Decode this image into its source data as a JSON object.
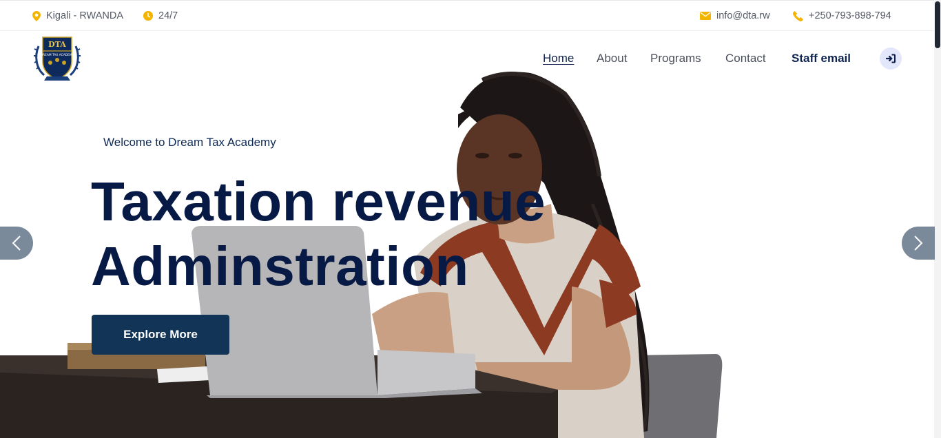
{
  "topbar": {
    "location": "Kigali - RWANDA",
    "hours": "24/7",
    "email": "info@dta.rw",
    "phone": "+250-793-898-794"
  },
  "logo": {
    "initials": "DTA",
    "name": "DREAM TAX ACADEMY"
  },
  "nav": {
    "home": "Home",
    "about": "About",
    "programs": "Programs",
    "contact": "Contact",
    "staff_email": "Staff email"
  },
  "hero": {
    "welcome": "Welcome to Dream Tax Academy",
    "headline_line1": "Taxation revenue",
    "headline_line2": "Adminstration",
    "cta": "Explore More"
  },
  "icons": {
    "location": "map-pin-icon",
    "hours": "clock-icon",
    "email": "envelope-icon",
    "phone": "phone-icon",
    "login": "sign-in-icon",
    "prev": "chevron-left-icon",
    "next": "chevron-right-icon"
  },
  "colors": {
    "accent": "#f5b400",
    "navy": "#071a45",
    "button": "#123456",
    "arrow_bg": "#7b8a9a"
  }
}
